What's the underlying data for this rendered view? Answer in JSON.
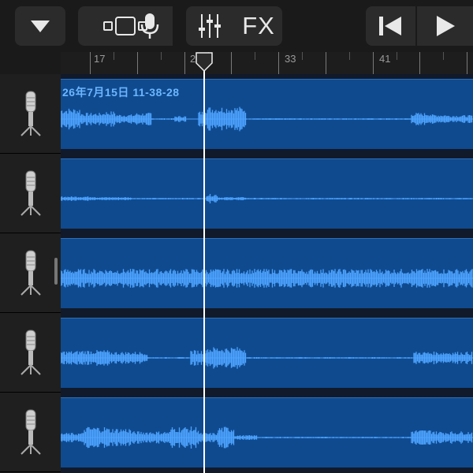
{
  "toolbar": {
    "fx_label": "FX",
    "buttons": [
      {
        "name": "browser-menu-button",
        "icon": "triangle-down-icon"
      },
      {
        "name": "tracks-view-button",
        "icon": "tracks-view-icon"
      },
      {
        "name": "record-button",
        "icon": "microphone-icon"
      },
      {
        "name": "mixer-button",
        "icon": "sliders-icon"
      },
      {
        "name": "fx-button",
        "icon": "fx-icon"
      },
      {
        "name": "go-to-start-button",
        "icon": "skip-back-icon"
      },
      {
        "name": "play-button",
        "icon": "play-icon"
      }
    ]
  },
  "ruler": {
    "bar_labels": [
      "17",
      "25",
      "33",
      "41"
    ]
  },
  "tracks": [
    {
      "instrument_icon": "microphone-icon",
      "region_label": "26年7月15日 11-38-28"
    },
    {
      "instrument_icon": "microphone-icon",
      "region_label": ""
    },
    {
      "instrument_icon": "microphone-icon",
      "region_label": ""
    },
    {
      "instrument_icon": "microphone-icon",
      "region_label": ""
    },
    {
      "instrument_icon": "microphone-icon",
      "region_label": ""
    }
  ],
  "colors": {
    "region_fill": "#0f4a8f",
    "waveform": "#4da3ff",
    "region_label": "#6cb6ff",
    "playhead": "#ffffff"
  }
}
